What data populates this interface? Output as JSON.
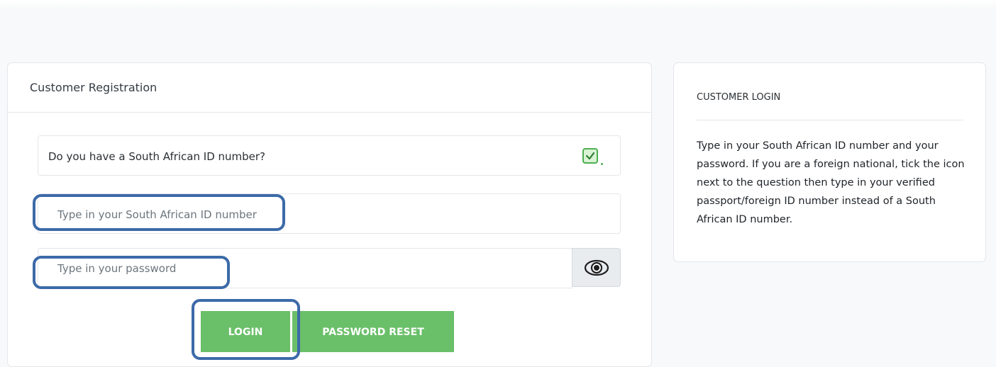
{
  "registration": {
    "title": "Customer Registration",
    "question": "Do you have a South African ID number?",
    "id_placeholder": "Type in your South African ID number",
    "password_placeholder": "Type in your password",
    "login_label": "LOGIN",
    "reset_label": "PASSWORD RESET"
  },
  "login_panel": {
    "title": "CUSTOMER LOGIN",
    "instructions": "Type in your South African ID number and your password. If you are a foreign national, tick the icon next to the question then type in your verified passport/foreign ID number instead of a South African ID number."
  },
  "icons": {
    "checkbox": "checkbox-checked-icon",
    "show_password": "eye-icon"
  },
  "colors": {
    "button_green": "#6abf69",
    "checkbox_green": "#4caf50",
    "highlight_blue": "#3c6aa8"
  }
}
